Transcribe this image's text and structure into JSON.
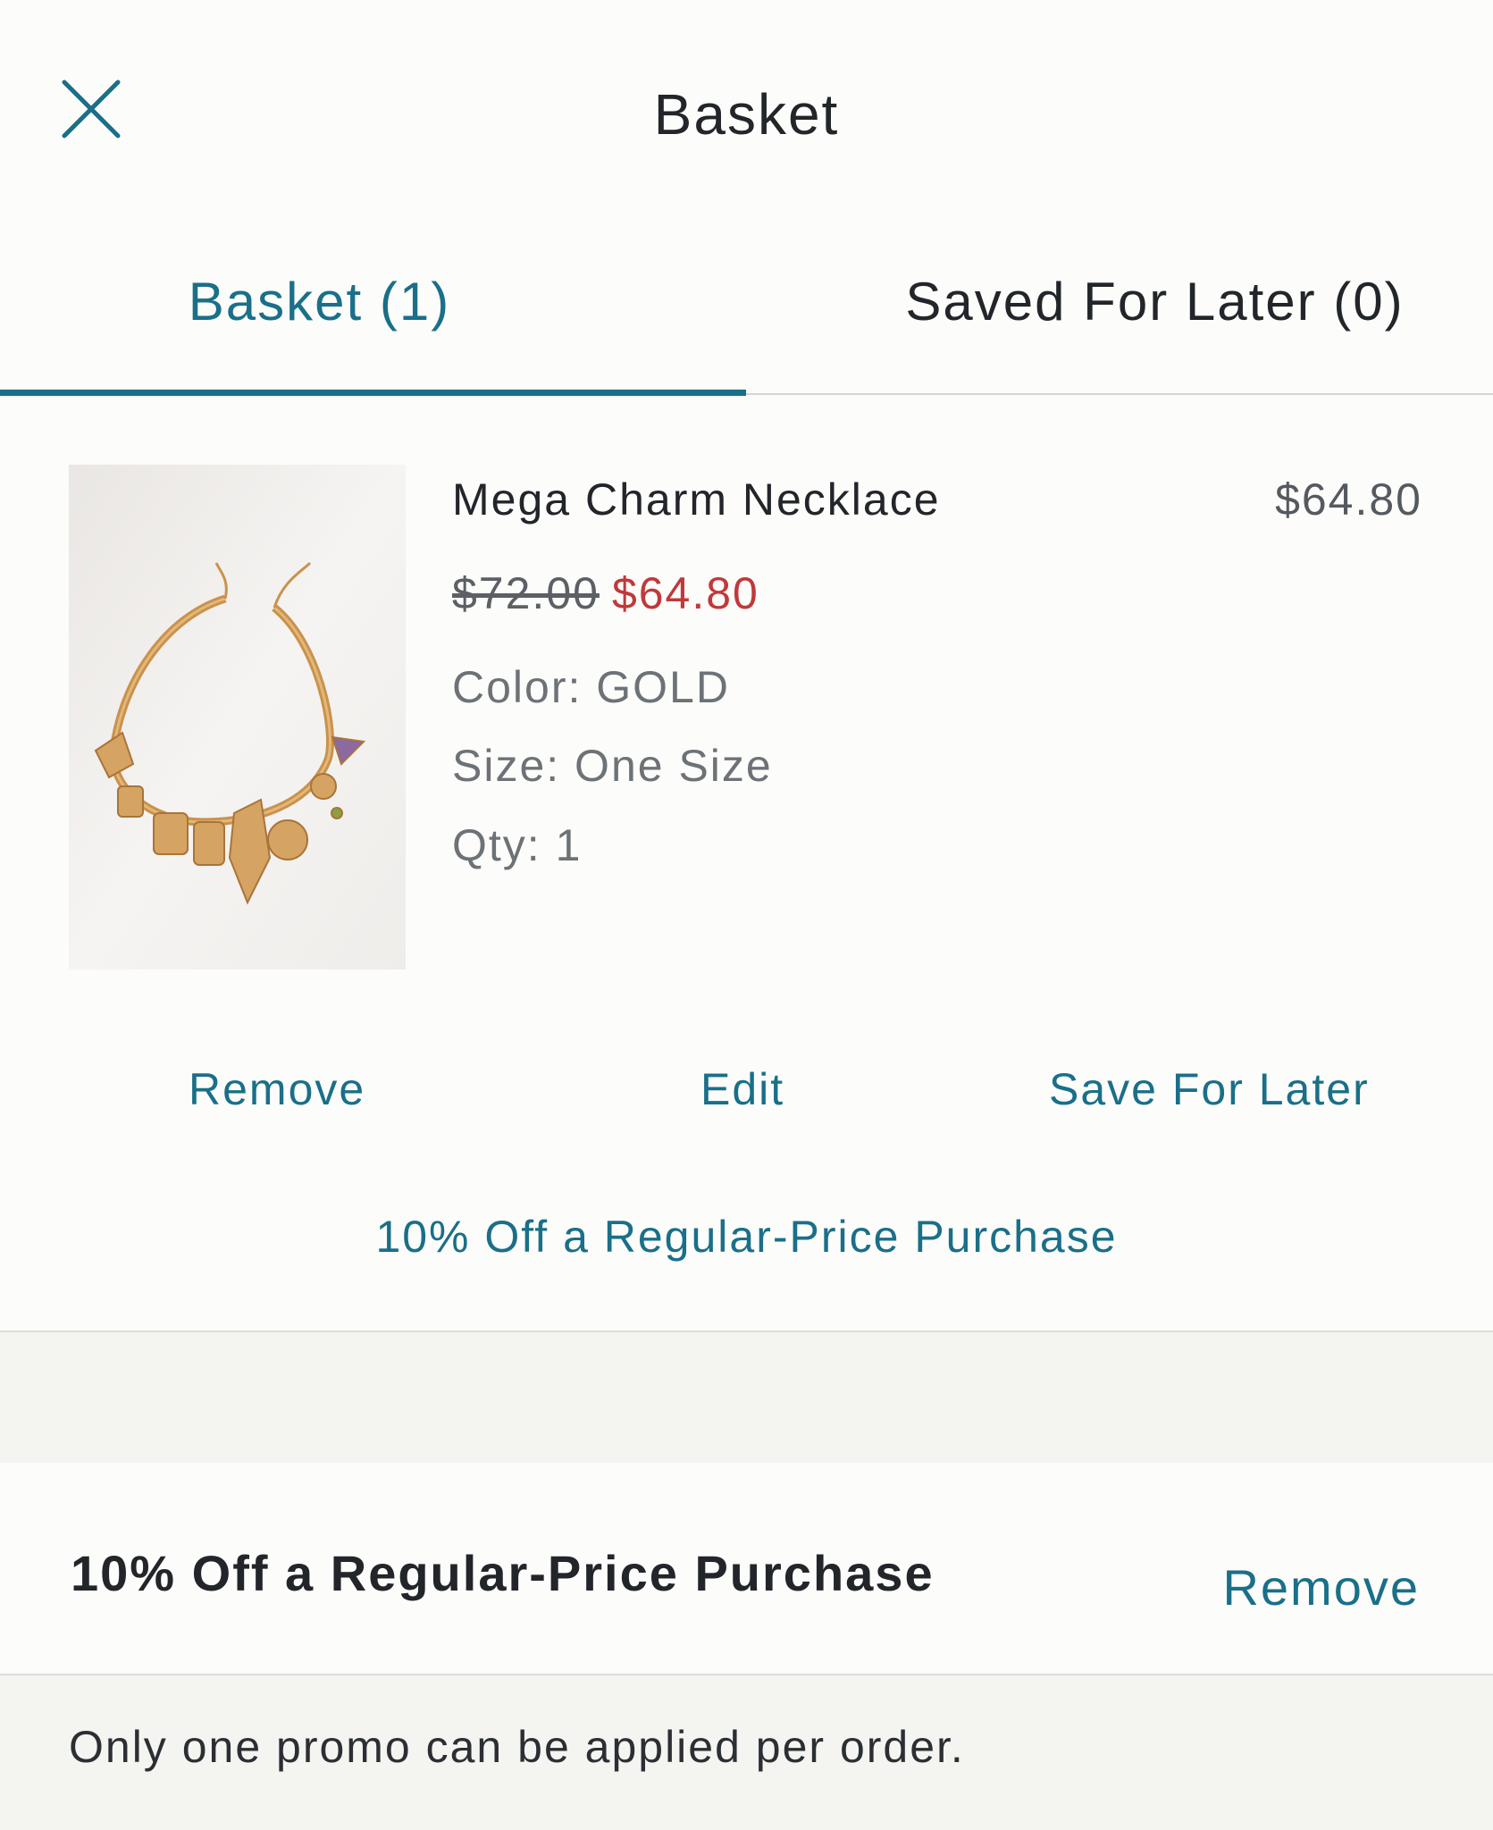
{
  "header": {
    "title": "Basket",
    "close_icon": "close-icon"
  },
  "tabs": [
    {
      "label": "Basket (1)",
      "active": true
    },
    {
      "label": "Saved For Later (0)",
      "active": false
    }
  ],
  "product": {
    "name": "Mega Charm Necklace",
    "line_total": "$64.80",
    "original_price": "$72.00",
    "sale_price": "$64.80",
    "color": "Color: GOLD",
    "size": "Size: One Size",
    "qty": "Qty: 1",
    "actions": {
      "remove": "Remove",
      "edit": "Edit",
      "save_for_later": "Save For Later"
    },
    "promo_link": "10% Off a Regular-Price Purchase"
  },
  "promo_applied": {
    "title": "10% Off a Regular-Price Purchase",
    "remove": "Remove",
    "note": "Only one promo can be applied per order."
  },
  "colors": {
    "accent": "#1a6f89",
    "sale": "#c0393b",
    "background": "#fcfcfa"
  }
}
